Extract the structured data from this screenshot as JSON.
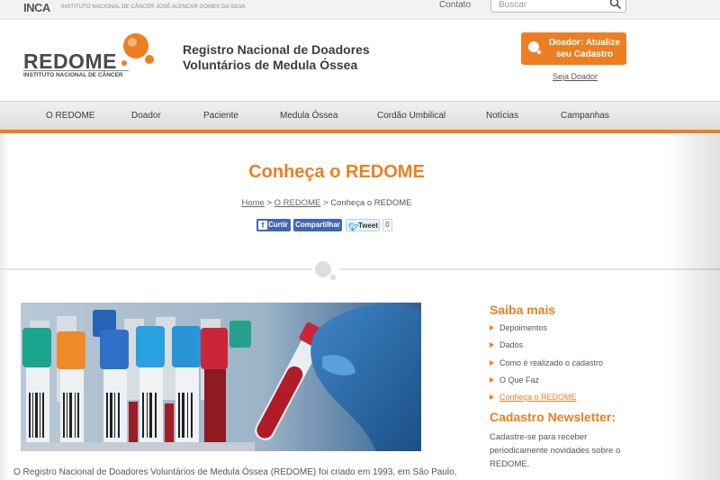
{
  "topbar": {
    "inca_logo": "INCA",
    "inca_subtitle": "INSTITUTO NACIONAL DE CÂNCER JOSÉ ALENCAR GOMES DA SILVA",
    "contato": "Contato",
    "search_placeholder": "Buscar"
  },
  "header": {
    "logo_word": "REDOME",
    "logo_subtitle": "INSTITUTO NACIONAL DE CÂNCER",
    "site_title": "Registro Nacional de Doadores Voluntários de Medula Óssea",
    "cta_label": "Doador: Atualize seu Cadastro",
    "seja_doador": "Seja Doador"
  },
  "nav": {
    "items": [
      {
        "label": "O REDOME"
      },
      {
        "label": "Doador"
      },
      {
        "label": "Paciente"
      },
      {
        "label": "Medula Óssea"
      },
      {
        "label": "Cordão Umbilical"
      },
      {
        "label": "Notícias"
      },
      {
        "label": "Campanhas"
      }
    ]
  },
  "page": {
    "title": "Conheça o REDOME",
    "breadcrumb": {
      "home": "Home",
      "sep1": " > ",
      "parent": "O REDOME",
      "sep2": " > ",
      "current": "Conheça o REDOME"
    },
    "share": {
      "curtir": "Curtir",
      "compartilhar": "Compartilhar",
      "tweet": "Tweet",
      "tweet_count": "0"
    },
    "body_text": "O Registro Nacional de Doadores Voluntários de Medula Óssea (REDOME) foi criado em 1993, em São Paulo,"
  },
  "sidebar": {
    "title": "Saiba mais",
    "links": [
      {
        "label": "Depoimentos"
      },
      {
        "label": "Dados"
      },
      {
        "label": "Como é realizado o cadastro"
      },
      {
        "label": "O Que Faz"
      },
      {
        "label": "Conheça o REDOME"
      }
    ],
    "newsletter_title": "Cadastro Newsletter:",
    "newsletter_text": "Cadastre-se para receber periodicamente novidades sobre o REDOME."
  },
  "colors": {
    "accent": "#ee7e21",
    "text": "#3c3c3c",
    "facebook": "#4267b2"
  }
}
